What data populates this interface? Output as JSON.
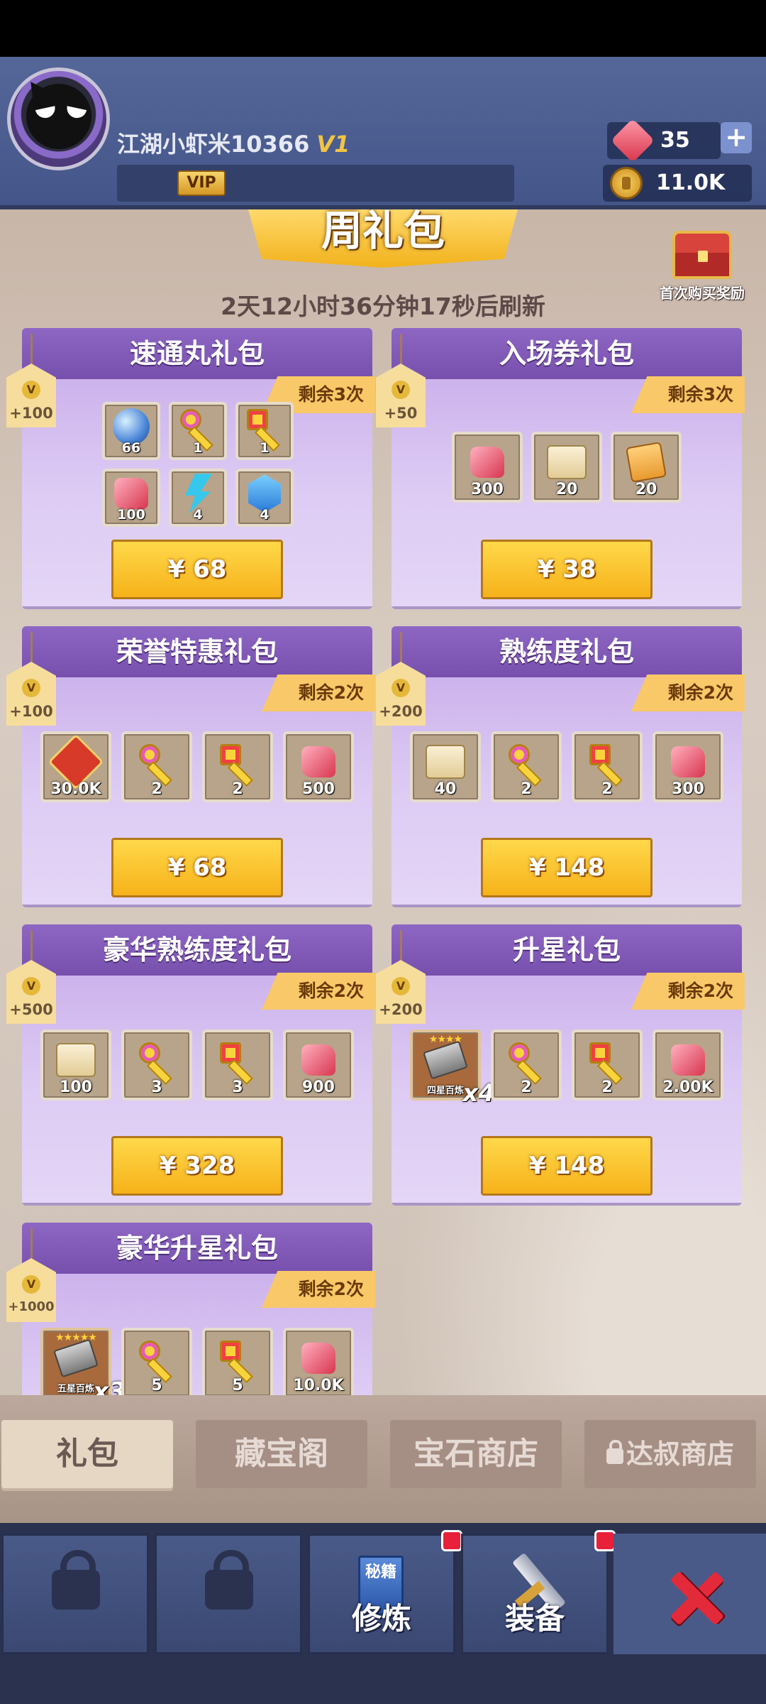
{
  "header": {
    "username": "江湖小虾米10366",
    "vip_level": "V1",
    "vip_badge": "VIP",
    "gems": "35",
    "coins": "11.0K",
    "plus": "+"
  },
  "banner": {
    "title": "周礼包",
    "refresh": "2天12小时36分钟17秒后刷新"
  },
  "first_reward": {
    "label": "首次购买奖励"
  },
  "packs": [
    {
      "title": "速通丸礼包",
      "remain": "剩余3次",
      "points": "+100",
      "price": "¥ 68",
      "items": [
        {
          "icon": "orb-icon",
          "qty": "66"
        },
        {
          "icon": "key-icon",
          "qty": "1"
        },
        {
          "icon": "key-red-icon",
          "qty": "1"
        },
        {
          "icon": "gem-icon",
          "qty": "100"
        },
        {
          "icon": "lightning-icon",
          "qty": "4"
        },
        {
          "icon": "crystal-icon",
          "qty": "4"
        }
      ]
    },
    {
      "title": "入场券礼包",
      "remain": "剩余3次",
      "points": "+50",
      "price": "¥ 38",
      "items": [
        {
          "icon": "gem-icon",
          "qty": "300"
        },
        {
          "icon": "scroll-ticket-icon",
          "qty": "20"
        },
        {
          "icon": "orange-ticket-icon",
          "qty": "20"
        }
      ]
    },
    {
      "title": "荣誉特惠礼包",
      "remain": "剩余2次",
      "points": "+100",
      "price": "¥ 68",
      "items": [
        {
          "icon": "honor-token-icon",
          "qty": "30.0K"
        },
        {
          "icon": "key-icon",
          "qty": "2"
        },
        {
          "icon": "key-red-icon",
          "qty": "2"
        },
        {
          "icon": "gem-icon",
          "qty": "500"
        }
      ]
    },
    {
      "title": "熟练度礼包",
      "remain": "剩余2次",
      "points": "+200",
      "price": "¥ 148",
      "items": [
        {
          "icon": "scroll-icon",
          "qty": "40"
        },
        {
          "icon": "key-icon",
          "qty": "2"
        },
        {
          "icon": "key-red-icon",
          "qty": "2"
        },
        {
          "icon": "gem-icon",
          "qty": "300"
        }
      ]
    },
    {
      "title": "豪华熟练度礼包",
      "remain": "剩余2次",
      "points": "+500",
      "price": "¥ 328",
      "items": [
        {
          "icon": "scroll-icon",
          "qty": "100"
        },
        {
          "icon": "key-icon",
          "qty": "3"
        },
        {
          "icon": "key-red-icon",
          "qty": "3"
        },
        {
          "icon": "gem-icon",
          "qty": "900"
        }
      ]
    },
    {
      "title": "升星礼包",
      "remain": "剩余2次",
      "points": "+200",
      "price": "¥ 148",
      "items": [
        {
          "icon": "star-book-icon",
          "qty": "四星百炼",
          "stars": "★★★★",
          "mult": "x4"
        },
        {
          "icon": "key-icon",
          "qty": "2"
        },
        {
          "icon": "key-red-icon",
          "qty": "2"
        },
        {
          "icon": "gem-icon",
          "qty": "2.00K"
        }
      ]
    },
    {
      "title": "豪华升星礼包",
      "remain": "剩余2次",
      "points": "+1000",
      "items": [
        {
          "icon": "star-book-icon",
          "qty": "五星百炼",
          "stars": "★★★★★",
          "mult": "x3"
        },
        {
          "icon": "key-icon",
          "qty": "5"
        },
        {
          "icon": "key-red-icon",
          "qty": "5"
        },
        {
          "icon": "gem-icon",
          "qty": "10.0K"
        }
      ]
    }
  ],
  "tabs": [
    {
      "label": "礼包",
      "active": true
    },
    {
      "label": "藏宝阁"
    },
    {
      "label": "宝石商店"
    },
    {
      "label": "达叔商店",
      "locked": true
    }
  ],
  "nav": {
    "train": "修炼",
    "train_book": "秘籍",
    "equip": "装备"
  },
  "colors": {
    "card": "#dcc7f3",
    "title_bar": "#7650ac",
    "buy": "#f6b21a",
    "remain": "#f9c868",
    "close": "#e32a3a"
  }
}
